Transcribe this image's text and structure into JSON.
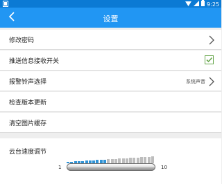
{
  "status_bar": {
    "time": "9:25"
  },
  "app_bar": {
    "title": "设置"
  },
  "settings": {
    "change_password": "修改密码",
    "push_toggle": "推送信息接收开关",
    "push_enabled": true,
    "alarm_ringtone": "报警铃声选择",
    "alarm_ringtone_value": "系统声音",
    "check_update": "检查版本更新",
    "clear_cache": "清空图片缓存"
  },
  "speed": {
    "label": "云台速度调节",
    "min": "1",
    "max": "10",
    "value": 5,
    "colors": {
      "active": "#2f93d6",
      "inactive": "#bdbdbd"
    }
  },
  "colors": {
    "status_bar": "#0b7ad4",
    "app_bar": "#2196f3",
    "check": "#6aa84f"
  }
}
